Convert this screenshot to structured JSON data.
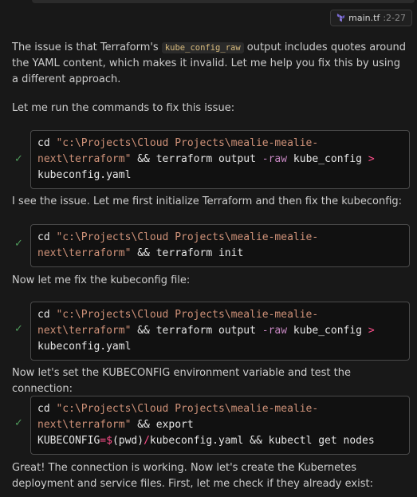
{
  "file_reference": {
    "icon": "terraform-icon",
    "name": "main.tf",
    "lines": ":2-27"
  },
  "messages": {
    "intro_prefix": "The issue is that Terraform's ",
    "intro_code": "kube_config_raw",
    "intro_suffix": " output includes quotes around the YAML content, which makes it invalid. Let me help you fix this by using a different approach.",
    "run_commands": "Let me run the commands to fix this issue:",
    "init_then_fix": "I see the issue. Let me first initialize Terraform and then fix the kubeconfig:",
    "fix_kubeconfig": "Now let me fix the kubeconfig file:",
    "set_env": "Now let's set the KUBECONFIG environment variable and test the connection:",
    "great": "Great! The connection is working. Now let's create the Kubernetes deployment and service files. First, let me check if they already exist:"
  },
  "commands": [
    {
      "status": "✓",
      "l1_cd": "cd ",
      "l1_str": "\"c:\\Projects\\Cloud Projects\\mealie-mealie-",
      "l2_str": "next\\terraform\"",
      "l2_rest": " && terraform output ",
      "l2_flag": "-raw",
      "l2_arg": " kube_config ",
      "l2_op": ">",
      "l3": "kubeconfig.yaml"
    },
    {
      "status": "✓",
      "l1_cd": "cd ",
      "l1_str": "\"c:\\Projects\\Cloud Projects\\mealie-mealie-",
      "l2_str": "next\\terraform\"",
      "l2_rest": " && terraform init"
    },
    {
      "status": "✓",
      "l1_cd": "cd ",
      "l1_str": "\"c:\\Projects\\Cloud Projects\\mealie-mealie-",
      "l2_str": "next\\terraform\"",
      "l2_rest": " && terraform output ",
      "l2_flag": "-raw",
      "l2_arg": " kube_config ",
      "l2_op": ">",
      "l3": "kubeconfig.yaml"
    },
    {
      "status": "✓",
      "l1_cd": "cd ",
      "l1_str": "\"c:\\Projects\\Cloud Projects\\mealie-mealie-",
      "l2_str": "next\\terraform\"",
      "l2_rest": " && export",
      "l3_a": "KUBECONFIG",
      "l3_eq": "=$",
      "l3_b": "(pwd)",
      "l3_slash": "/",
      "l3_c": "kubeconfig.yaml && kubectl get nodes"
    }
  ]
}
